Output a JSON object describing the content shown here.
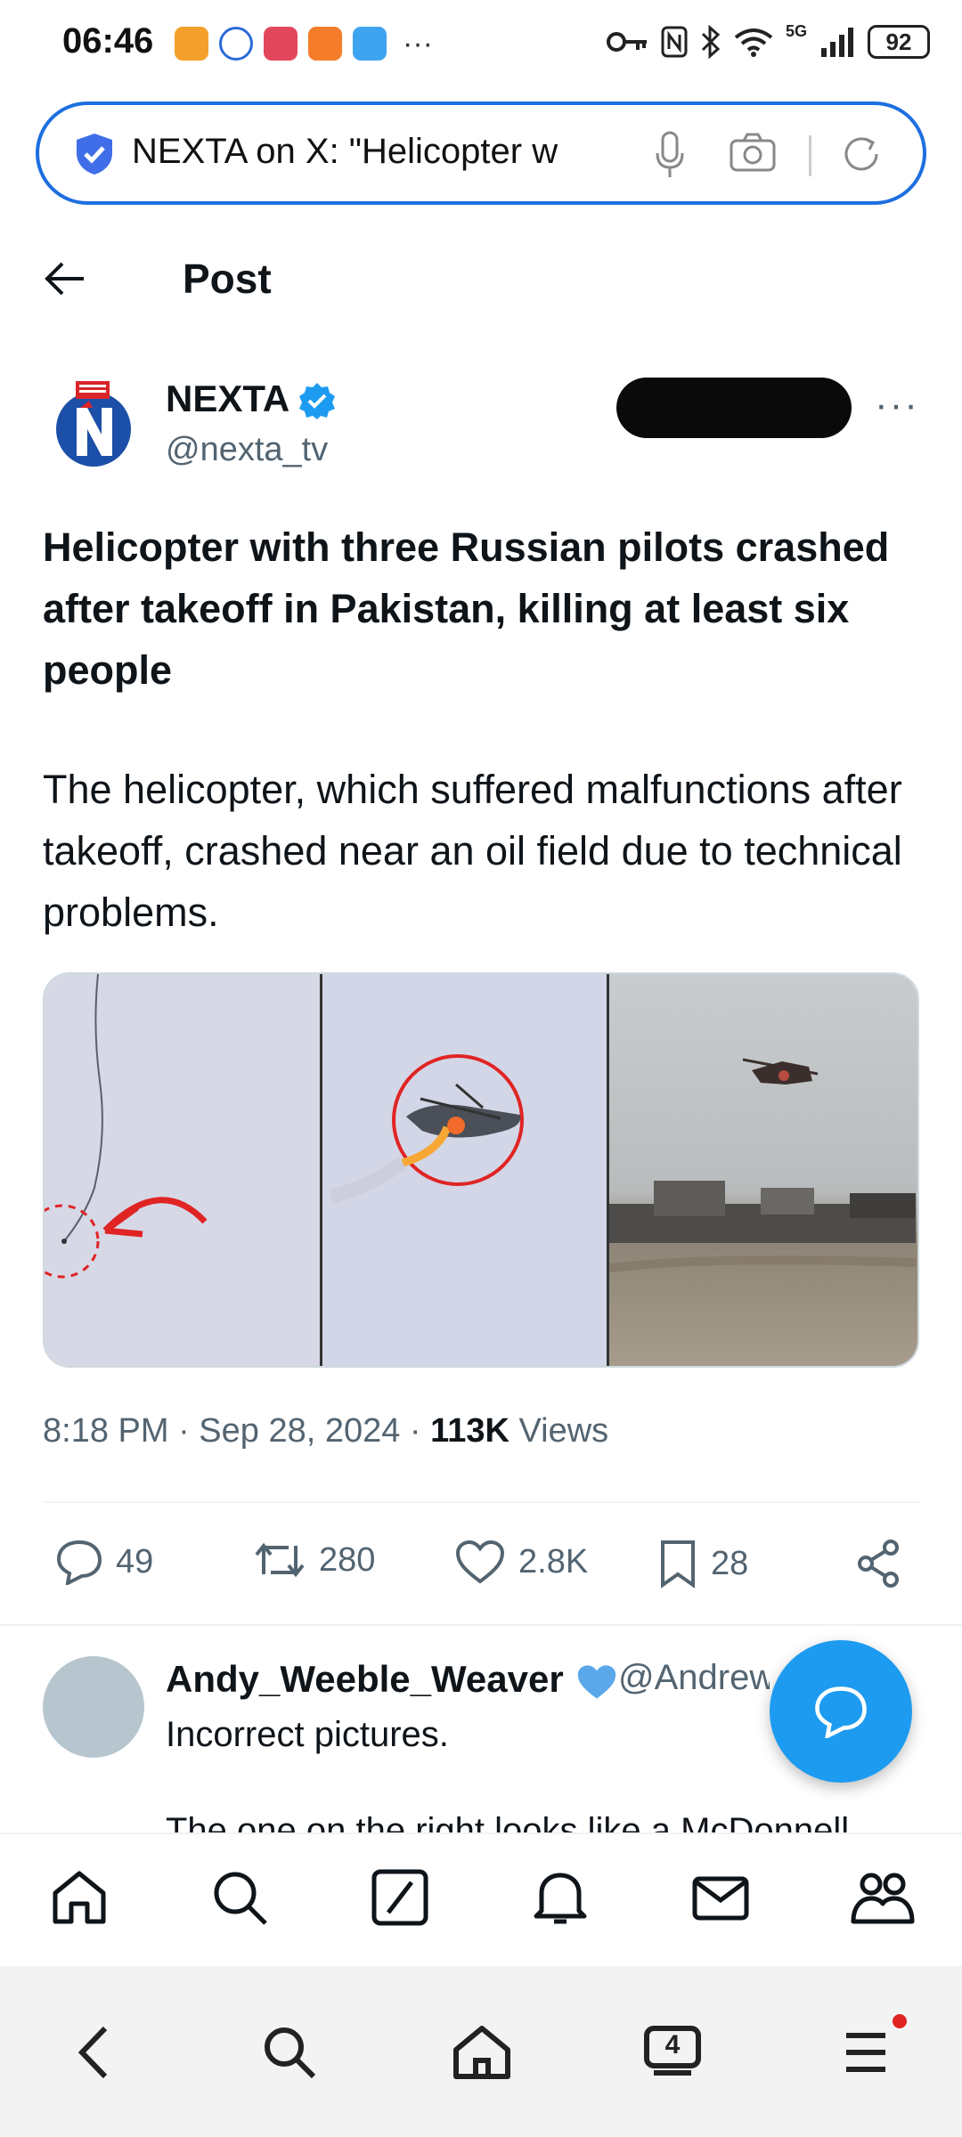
{
  "status_bar": {
    "time": "06:46",
    "overflow": "···",
    "battery": "92",
    "network": "5G"
  },
  "browser": {
    "url_text": "NEXTA on X: \"Helicopter w"
  },
  "header": {
    "title": "Post"
  },
  "post": {
    "author_name": "NEXTA",
    "author_handle": "@nexta_tv",
    "headline": "Helicopter with three Russian pilots crashed after takeoff in Pakistan, killing at least six people",
    "body": "The helicopter, which suffered malfunctions after takeoff, crashed near an oil field due to technical problems.",
    "timestamp": "8:18 PM · Sep 28, 2024 · ",
    "views_count": "113K",
    "views_label": " Views"
  },
  "actions": {
    "replies": "49",
    "reposts": "280",
    "likes": "2.8K",
    "bookmarks": "28"
  },
  "reply": {
    "name": "Andy_Weeble_Weaver",
    "handle": "@Andrew",
    "text": "Incorrect pictures.",
    "text_cut": "The one on the right looks like a McDonnell"
  },
  "colors": {
    "accent": "#1d9bf0",
    "url_border": "#1d6fe0",
    "secondary_text": "#536471"
  },
  "icons": {
    "nav": [
      "home-icon",
      "search-icon",
      "grok-icon",
      "notifications-icon",
      "messages-icon",
      "communities-icon"
    ],
    "system": [
      "back-icon",
      "search-icon",
      "home-icon",
      "tabs-icon",
      "menu-icon"
    ]
  },
  "system_nav": {
    "tabs_count": "4"
  }
}
